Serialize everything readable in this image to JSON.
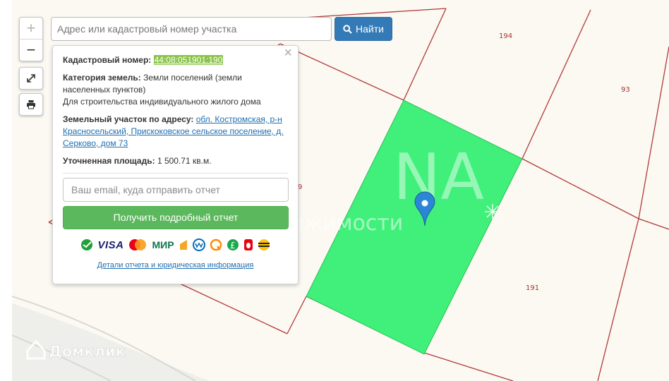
{
  "map": {
    "lot_labels": [
      "194",
      "93",
      "191",
      "9"
    ],
    "watermark": "Служба недвижимости",
    "logo": "Домклик",
    "colors": {
      "parcel": "#40f07a",
      "boundary": "#b23a3a",
      "background": "#fbf9f2"
    }
  },
  "controls": {
    "zoom_in": "+",
    "zoom_out": "−",
    "fullscreen_icon": "expand-icon",
    "print_icon": "printer-icon"
  },
  "search": {
    "placeholder": "Адрес или кадастровый номер участка",
    "value": "",
    "button_label": "Найти"
  },
  "popup": {
    "cad_label": "Кадастровый номер:",
    "cad_value": "44:08:051901:190",
    "category_label": "Категория земель:",
    "category_value": "Земли поселений (земли населенных пунктов)",
    "usage": "Для строительства индивидуального жилого дома",
    "address_label": "Земельный участок по адресу:",
    "address_value": "обл. Костромская, р-н Красносельский, Прискоковское сельское поселение, д. Серково, дом 73",
    "area_label": "Уточненная площадь:",
    "area_value": "1 500.71 кв.м.",
    "email_placeholder": "Ваш email, куда отправить отчет",
    "report_button": "Получить подробный отчет",
    "payment_methods": [
      "sberbank-icon",
      "visa-icon",
      "mastercard-icon",
      "mir-icon",
      "yandex-money-icon",
      "webmoney-icon",
      "qiwi-icon",
      "yandex-kassa-icon",
      "mts-icon",
      "beeline-icon"
    ],
    "visa_text": "VISA",
    "mir_text": "МИР",
    "details_link": "Детали отчета и юридическая информация"
  }
}
